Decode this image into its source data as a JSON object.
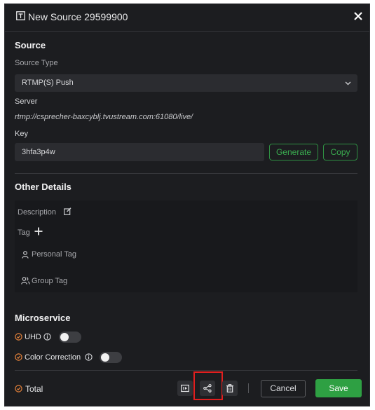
{
  "dialog": {
    "title": "New Source 29599900",
    "icons": {
      "title": "source-box-icon",
      "close": "close-icon"
    }
  },
  "source": {
    "section_title": "Source",
    "source_type_label": "Source Type",
    "source_type_value": "RTMP(S) Push",
    "server_label": "Server",
    "server_value": "rtmp://csprecher-baxcyblj.tvustream.com:61080/live/",
    "key_label": "Key",
    "key_value": "3hfa3p4w",
    "generate_label": "Generate",
    "copy_label": "Copy"
  },
  "other_details": {
    "section_title": "Other Details",
    "description_label": "Description",
    "tag_label": "Tag",
    "personal_tag_label": "Personal Tag",
    "group_tag_label": "Group Tag",
    "icons": {
      "description": "edit-icon",
      "tag_add": "plus-icon",
      "personal_tag": "person-icon",
      "group_tag": "group-icon"
    }
  },
  "microservice": {
    "section_title": "Microservice",
    "uhd_label": "UHD",
    "uhd_enabled": false,
    "color_correction_label": "Color Correction",
    "color_correction_enabled": false,
    "icons": {
      "service": "microservice-icon",
      "info": "info-icon"
    }
  },
  "footer": {
    "total_label": "Total",
    "cancel_label": "Cancel",
    "save_label": "Save",
    "icons": {
      "first": "media-icon",
      "second": "share-icon",
      "third": "trash-icon"
    }
  },
  "colors": {
    "accent_green": "#2ea043",
    "accent_orange": "#e8833a",
    "highlight_red": "#e01f1f",
    "panel_bg": "#1c1d20"
  }
}
